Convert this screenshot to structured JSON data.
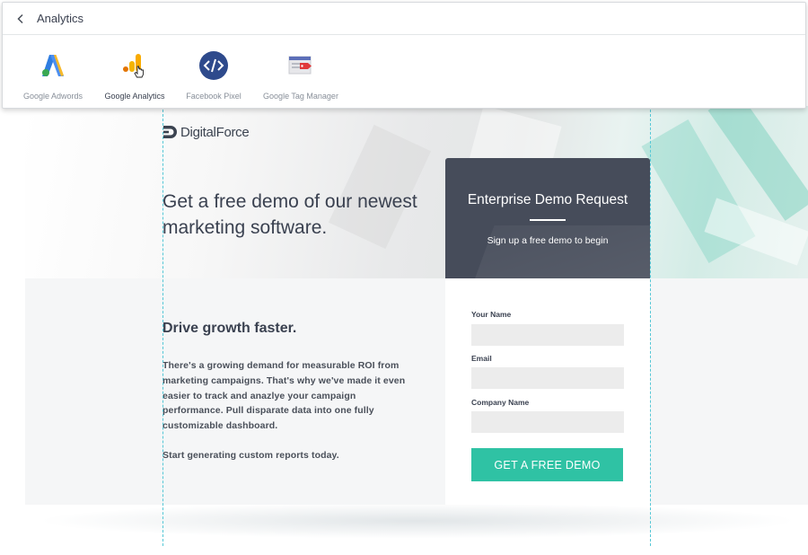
{
  "panel": {
    "title": "Analytics",
    "integrations": [
      {
        "label": "Google Adwords",
        "icon": "google-adwords-icon"
      },
      {
        "label": "Google Analytics",
        "icon": "google-analytics-icon",
        "active": true
      },
      {
        "label": "Facebook Pixel",
        "icon": "code-icon"
      },
      {
        "label": "Google Tag Manager",
        "icon": "tag-manager-icon"
      }
    ]
  },
  "landing": {
    "logo_text": "DigitalForce",
    "headline": "Get a free demo of our newest marketing software.",
    "subheading": "Drive growth faster.",
    "body_p1": "There's a growing demand for measurable ROI from marketing campaigns. That's why we've made it even easier to track and anazlye your campaign performance. Pull disparate data into one fully customizable dashboard.",
    "body_p2": "Start generating custom reports today.",
    "form": {
      "title": "Enterprise Demo Request",
      "subtitle": "Sign up a free demo to begin",
      "fields": [
        {
          "label": "Your Name",
          "value": ""
        },
        {
          "label": "Email",
          "value": ""
        },
        {
          "label": "Company Name",
          "value": ""
        }
      ],
      "cta": "GET A FREE DEMO"
    }
  },
  "colors": {
    "accent": "#2fc2a4",
    "form_header": "#464c5a",
    "guide": "#55c7d6"
  }
}
